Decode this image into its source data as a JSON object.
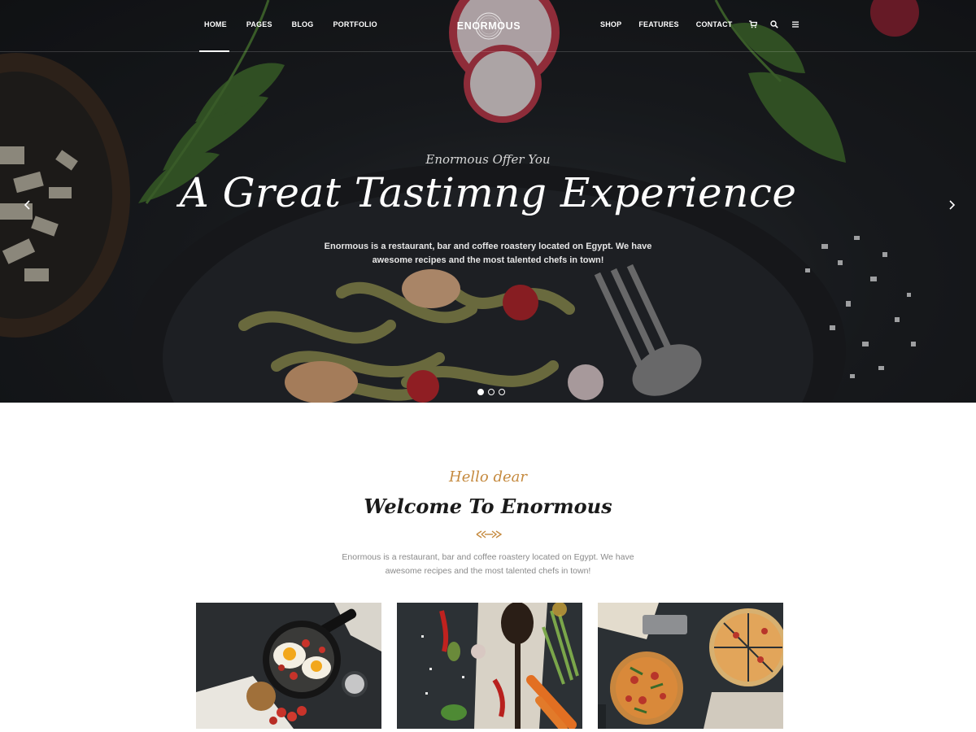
{
  "nav": {
    "left_items": [
      "HOME",
      "PAGES",
      "BLOG",
      "PORTFOLIO"
    ],
    "right_items": [
      "SHOP",
      "FEATURES",
      "CONTACT"
    ],
    "active": "HOME",
    "icons": [
      "cart-icon",
      "search-icon",
      "menu-icon"
    ]
  },
  "logo": {
    "text": "ENORMOUS"
  },
  "hero": {
    "subtitle": "Enormous Offer You",
    "title": "A Great Tastimng Experience",
    "description": "Enormous is a restaurant, bar and coffee roastery located on Egypt. We have awesome recipes and the most talented chefs in town!",
    "slides": 3,
    "active_slide": 1
  },
  "welcome": {
    "kicker": "Hello dear",
    "title": "Welcome To Enormous",
    "description": "Enormous is a restaurant, bar and coffee roastery located on Egypt. We have awesome recipes and the most talented chefs in town!"
  },
  "colors": {
    "accent": "#c58a3f",
    "hero_dark": "#1c1f22",
    "text_dark": "#1a1a1a",
    "text_muted": "#8a8a8a"
  },
  "cards": [
    "fried-eggs-pan-photo",
    "vegetables-spoon-photo",
    "pizza-photo"
  ]
}
